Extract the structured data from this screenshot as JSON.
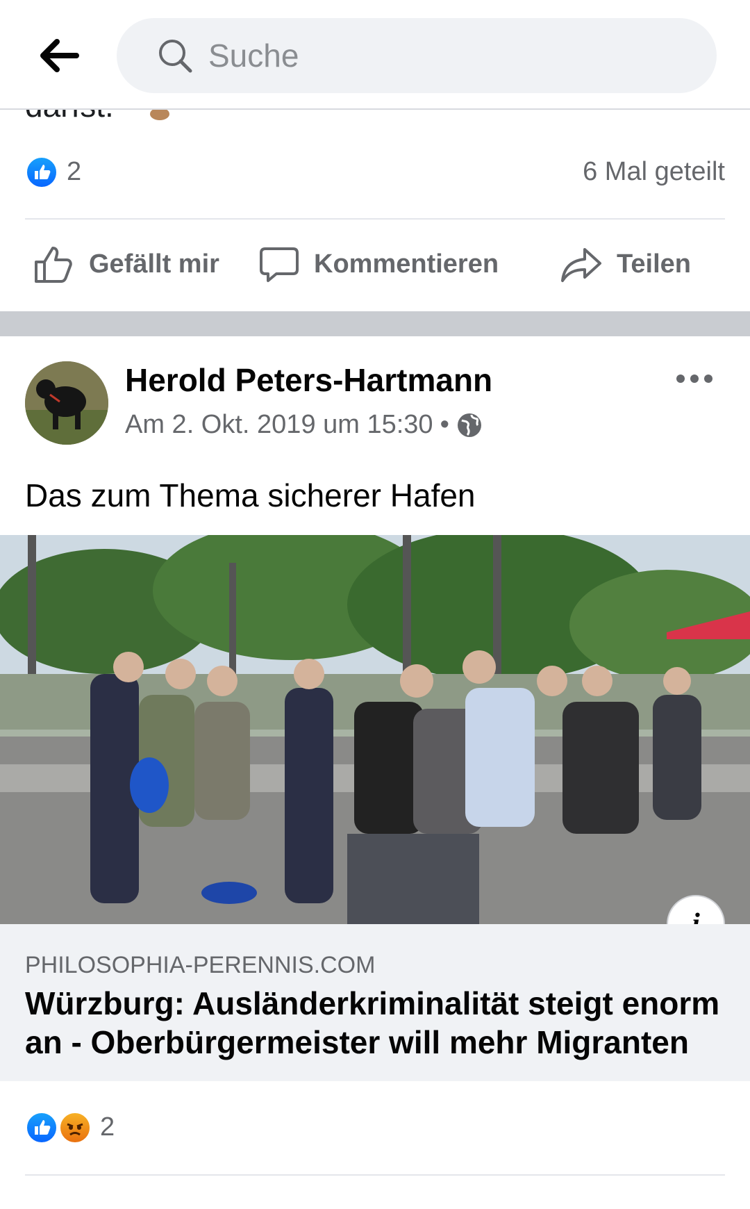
{
  "search": {
    "placeholder": "Suche"
  },
  "previous_post": {
    "tail_text": "darfst.",
    "reaction_count": "2",
    "shares": "6 Mal geteilt",
    "actions": {
      "like": "Gefällt mir",
      "comment": "Kommentieren",
      "share": "Teilen"
    }
  },
  "post": {
    "author": "Herold Peters-Hartmann",
    "timestamp": "Am 2. Okt. 2019 um 15:30",
    "separator": "•",
    "text": "Das zum Thema sicherer Hafen",
    "link": {
      "domain": "PHILOSOPHIA-PERENNIS.COM",
      "title": "Würzburg: Ausländerkriminalität steigt enorm an - Oberbürgermeister will mehr Migranten",
      "info_label": "i"
    },
    "reaction_count": "2"
  },
  "colors": {
    "like_blue": "#0866ff",
    "angry_orange": "#e9710f",
    "text_secondary": "#65676b"
  },
  "icons": [
    "back-arrow-icon",
    "search-icon",
    "like-icon",
    "comment-icon",
    "share-icon",
    "globe-icon",
    "more-icon",
    "info-icon",
    "angry-reaction-icon"
  ]
}
